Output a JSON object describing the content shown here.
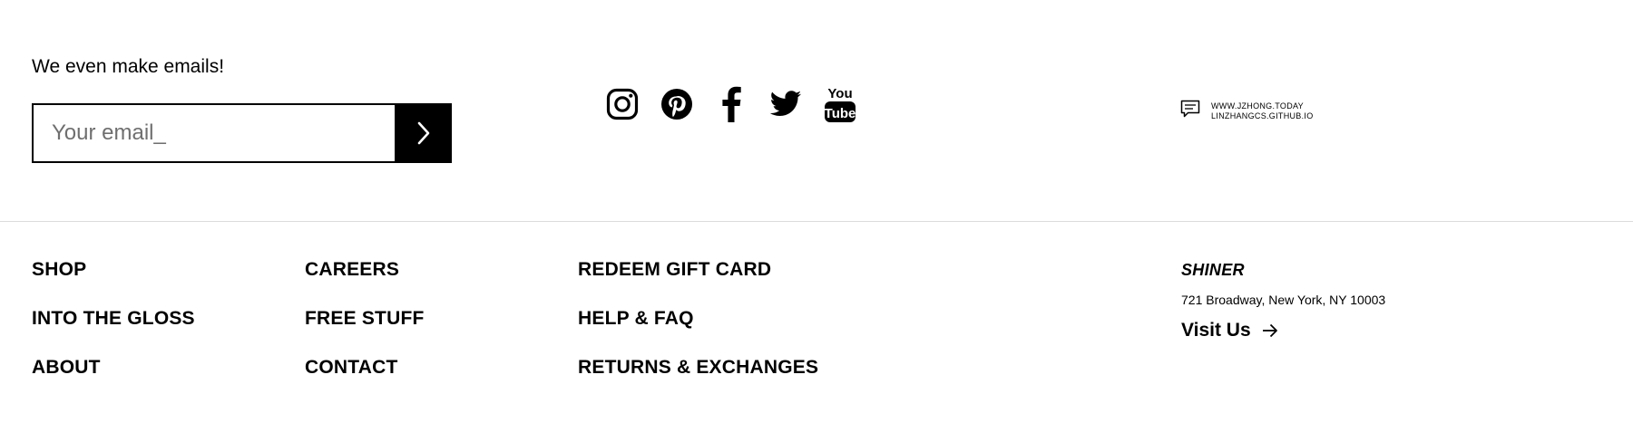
{
  "newsletter": {
    "heading": "We even make emails!",
    "email_placeholder": "Your email_",
    "email_value": "",
    "submit_icon": "chevron-right-icon"
  },
  "social": {
    "icons": [
      "instagram-icon",
      "pinterest-icon",
      "facebook-icon",
      "twitter-icon",
      "youtube-icon"
    ],
    "youtube_you": "You",
    "youtube_tube": "Tube"
  },
  "contact": {
    "icon": "message-icon",
    "lines": [
      "WWW.JZHONG.TODAY",
      "LINZHANGCS.GITHUB.IO"
    ]
  },
  "footer_nav": {
    "column_1": [
      "SHOP",
      "INTO THE GLOSS",
      "ABOUT"
    ],
    "column_2": [
      "CAREERS",
      "FREE STUFF",
      "CONTACT"
    ],
    "column_3": [
      "REDEEM GIFT CARD",
      "HELP & FAQ",
      "RETURNS & EXCHANGES"
    ]
  },
  "store": {
    "name": "SHINER",
    "address": "721 Broadway, New York, NY 10003",
    "visit_label": "Visit Us",
    "visit_icon": "arrow-right-icon"
  },
  "colors": {
    "text": "#000000",
    "background": "#ffffff",
    "divider": "#dcdcdc",
    "placeholder": "#6f6f6f"
  }
}
